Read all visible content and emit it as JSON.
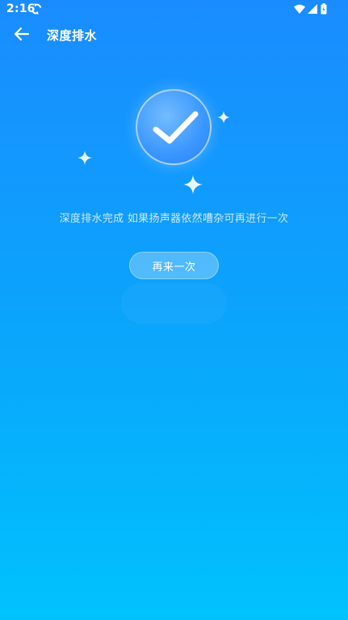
{
  "status_bar": {
    "time": "2:16",
    "icons": [
      "sync-icon",
      "wifi-icon",
      "signal-icon",
      "battery-icon"
    ]
  },
  "app_bar": {
    "back_icon": "arrow-left-icon",
    "title": "深度排水"
  },
  "result": {
    "status_icon": "check-mark-icon",
    "message": "深度排水完成 如果扬声器依然嘈杂可再进行一次"
  },
  "actions": {
    "retry_label": "再来一次"
  },
  "colors": {
    "background_top": "#1a8cff",
    "background_bottom": "#00c2fd",
    "text": "#ffffff"
  }
}
